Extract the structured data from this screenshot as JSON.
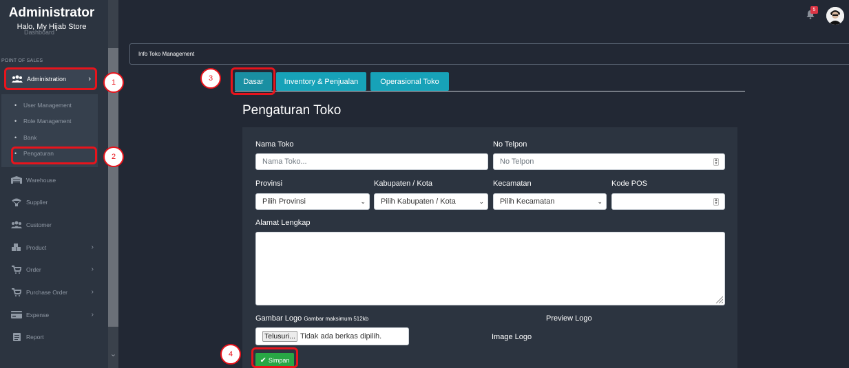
{
  "sidebar": {
    "brand_title": "Administrator",
    "brand_sub": "Halo, My Hijab Store",
    "ghost_item": "Dashboard",
    "section_label": "POINT OF SALES",
    "active_item": "Administration",
    "submenu": [
      "User Management",
      "Role Management",
      "Bank",
      "Pengaturan"
    ],
    "items": [
      "Warehouse",
      "Supplier",
      "Customer",
      "Product",
      "Order",
      "Purchase Order",
      "Expense",
      "Report"
    ]
  },
  "topbar": {
    "notification_count": "5"
  },
  "infobar": {
    "title": "Info Toko Management"
  },
  "tabs": [
    "Dasar",
    "Inventory & Penjualan",
    "Operasional Toko"
  ],
  "page_title": "Pengaturan Toko",
  "form": {
    "nama_toko_label": "Nama Toko",
    "nama_toko_placeholder": "Nama Toko...",
    "no_telpon_label": "No Telpon",
    "no_telpon_placeholder": "No Telpon",
    "provinsi_label": "Provinsi",
    "provinsi_value": "Pilih Provinsi",
    "kabupaten_label": "Kabupaten / Kota",
    "kabupaten_value": "Pilih Kabupaten / Kota",
    "kecamatan_label": "Kecamatan",
    "kecamatan_value": "Pilih Kecamatan",
    "kode_pos_label": "Kode POS",
    "alamat_label": "Alamat Lengkap",
    "logo_label": "Gambar Logo",
    "logo_note": "Gambar maksimum 512kb",
    "file_button": "Telusuri...",
    "file_status": "Tidak ada berkas dipilih.",
    "preview_label": "Preview Logo",
    "image_alt": "Image Logo",
    "save_label": "Simpan"
  },
  "annotations": [
    "1",
    "2",
    "3",
    "4"
  ],
  "colors": {
    "accent_tab": "#17a2b8",
    "save": "#28a745",
    "highlight": "#e8141c"
  }
}
